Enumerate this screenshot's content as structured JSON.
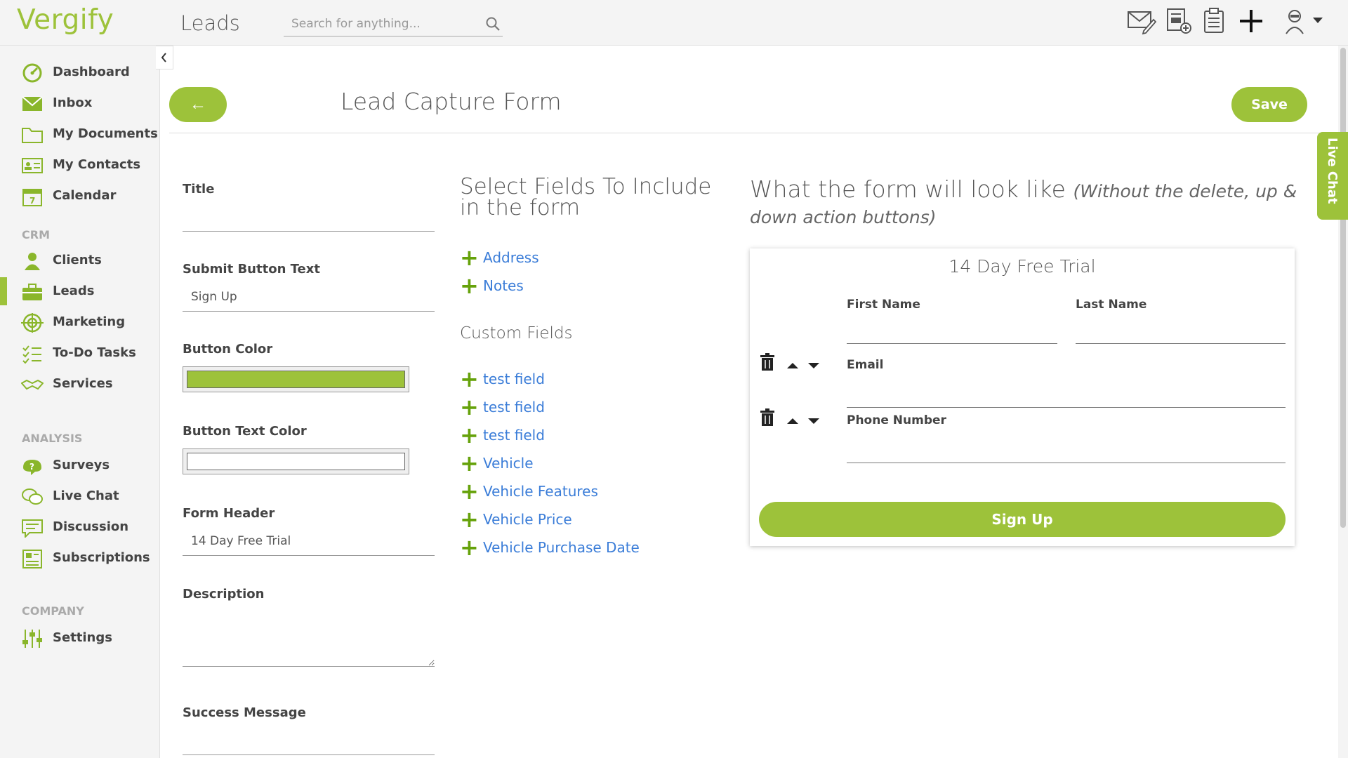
{
  "app": {
    "logo": "Vergify",
    "page_heading": "Leads"
  },
  "search": {
    "placeholder": "Search for anything..."
  },
  "sidebar": {
    "items": [
      {
        "label": "Dashboard",
        "icon": "dashboard-icon"
      },
      {
        "label": "Inbox",
        "icon": "inbox-icon"
      },
      {
        "label": "My Documents",
        "icon": "folder-icon"
      },
      {
        "label": "My Contacts",
        "icon": "contacts-icon"
      },
      {
        "label": "Calendar",
        "icon": "calendar-icon"
      }
    ],
    "crm_label": "CRM",
    "crm_items": [
      {
        "label": "Clients",
        "icon": "person-icon"
      },
      {
        "label": "Leads",
        "icon": "briefcase-icon"
      },
      {
        "label": "Marketing",
        "icon": "target-icon"
      },
      {
        "label": "To-Do Tasks",
        "icon": "checklist-icon"
      },
      {
        "label": "Services",
        "icon": "handshake-icon"
      }
    ],
    "analysis_label": "ANALYSIS",
    "analysis_items": [
      {
        "label": "Surveys",
        "icon": "survey-icon"
      },
      {
        "label": "Live Chat",
        "icon": "chat-bubbles-icon"
      },
      {
        "label": "Discussion",
        "icon": "discussion-icon"
      },
      {
        "label": "Subscriptions",
        "icon": "subscriptions-icon"
      }
    ],
    "company_label": "COMPANY",
    "company_items": [
      {
        "label": "Settings",
        "icon": "sliders-icon"
      }
    ],
    "active": "Leads"
  },
  "header": {
    "back_label": "←",
    "title": "Lead Capture Form",
    "save_label": "Save"
  },
  "live_chat_label": "Live Chat",
  "form_settings": {
    "title_label": "Title",
    "title_value": "",
    "submit_label": "Submit Button Text",
    "submit_value": "Sign Up",
    "button_color_label": "Button Color",
    "button_color": "#9dc23a",
    "button_text_color_label": "Button Text Color",
    "button_text_color": "#ffffff",
    "form_header_label": "Form Header",
    "form_header_value": "14 Day Free Trial",
    "description_label": "Description",
    "success_label": "Success Message"
  },
  "fields_panel": {
    "heading": "Select Fields To Include in the form",
    "fields": [
      "Address",
      "Notes"
    ],
    "custom_heading": "Custom Fields",
    "custom_fields": [
      "test field",
      "test field",
      "test field",
      "Vehicle",
      "Vehicle Features",
      "Vehicle Price",
      "Vehicle Purchase Date"
    ]
  },
  "preview": {
    "heading": "What the form will look like",
    "heading_note": "(Without the delete, up & down action buttons)",
    "form_title": "14 Day Free Trial",
    "first_name": "First Name",
    "last_name": "Last Name",
    "email": "Email",
    "phone": "Phone Number",
    "submit": "Sign Up"
  },
  "colors": {
    "accent": "#9dc23a",
    "link": "#3b7dd8",
    "plus": "#66a20b"
  }
}
